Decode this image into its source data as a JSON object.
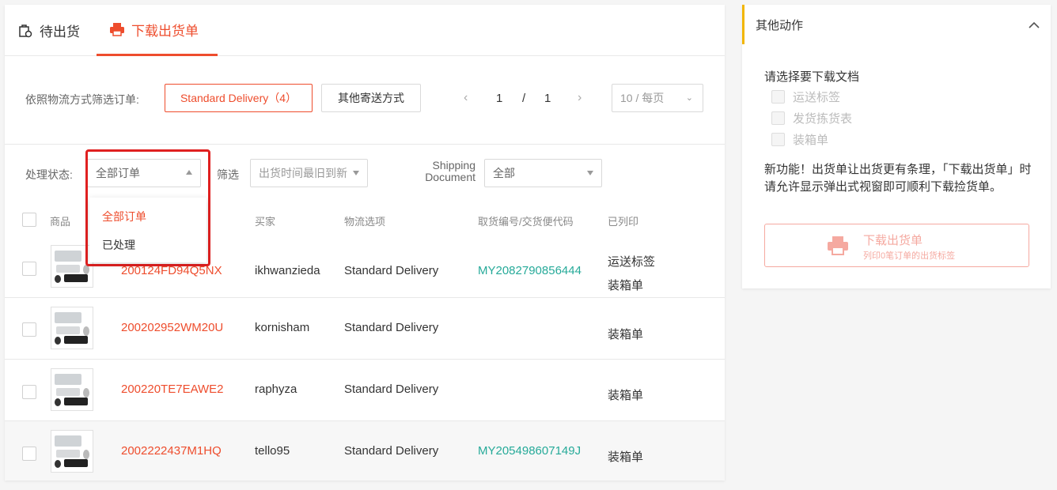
{
  "tabs": {
    "pending": "待出货",
    "download": "下载出货单"
  },
  "filter": {
    "logistics_label": "依照物流方式筛选订单:",
    "standard_btn": "Standard Delivery（4）",
    "other_btn": "其他寄送方式"
  },
  "pager": {
    "current": "1",
    "sep": "/",
    "total": "1",
    "per_page": "10 / 每页"
  },
  "status": {
    "label": "处理状态:",
    "value": "全部订单",
    "sort_label": "筛选",
    "sort_value": "出货时间最旧到新",
    "shipping_doc_label_1": "Shipping",
    "shipping_doc_label_2": "Document",
    "shipping_doc_value": "全部"
  },
  "dropdown": {
    "options": [
      "全部订单",
      "已处理"
    ]
  },
  "table": {
    "headers": {
      "product": "商品",
      "buyer": "买家",
      "logistics": "物流选项",
      "tracking": "取货编号/交货便代码",
      "printed": "已列印"
    },
    "rows": [
      {
        "order": "200124FD94Q5NX",
        "buyer": "ikhwanzieda",
        "logistics": "Standard Delivery",
        "tracking": "MY2082790856444",
        "printed1": "运送标签",
        "printed2": "装箱单"
      },
      {
        "order": "200202952WM20U",
        "buyer": "kornisham",
        "logistics": "Standard Delivery",
        "tracking": "",
        "printed1": "",
        "printed2": "装箱单"
      },
      {
        "order": "200220TE7EAWE2",
        "buyer": "raphyza",
        "logistics": "Standard Delivery",
        "tracking": "",
        "printed1": "",
        "printed2": "装箱单"
      },
      {
        "order": "2002222437M1HQ",
        "buyer": "tello95",
        "logistics": "Standard Delivery",
        "tracking": "MY205498607149J",
        "printed1": "",
        "printed2": "装箱单"
      }
    ]
  },
  "side": {
    "title": "其他动作",
    "choose_label": "请选择要下载文档",
    "options": [
      "运送标签",
      "发货拣货表",
      "装箱单"
    ],
    "note": "新功能！出货单让出货更有条理，「下载出货单」时请允许显示弹出式视窗即可顺利下载捡货单。",
    "download_btn": "下载出货单",
    "download_sub": "列印0笔订单的出货标签"
  },
  "colors": {
    "brand": "#ee4d2d",
    "teal": "#26aa99",
    "accent": "#f2b600",
    "highlight": "#e02020"
  }
}
